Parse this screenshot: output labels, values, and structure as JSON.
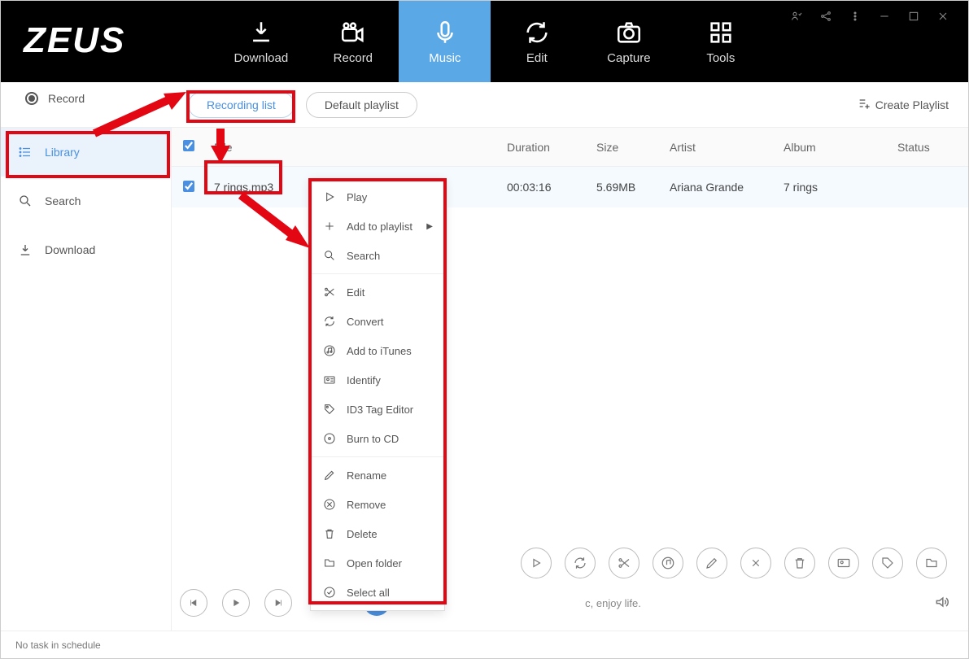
{
  "app": {
    "logo": "ZEUS"
  },
  "nav": [
    {
      "label": "Download"
    },
    {
      "label": "Record"
    },
    {
      "label": "Music"
    },
    {
      "label": "Edit"
    },
    {
      "label": "Capture"
    },
    {
      "label": "Tools"
    }
  ],
  "toolbar": {
    "record": "Record",
    "recording_list": "Recording list",
    "default_playlist": "Default playlist",
    "create_playlist": "Create Playlist"
  },
  "sidebar": {
    "library": "Library",
    "search": "Search",
    "download": "Download"
  },
  "table": {
    "headers": {
      "file": "File",
      "duration": "Duration",
      "size": "Size",
      "artist": "Artist",
      "album": "Album",
      "status": "Status"
    },
    "rows": [
      {
        "file": "7 rings.mp3",
        "duration": "00:03:16",
        "size": "5.69MB",
        "artist": "Ariana Grande",
        "album": "7 rings",
        "status": ""
      }
    ]
  },
  "context_menu": {
    "play": "Play",
    "add_to_playlist": "Add to playlist",
    "search": "Search",
    "edit": "Edit",
    "convert": "Convert",
    "add_to_itunes": "Add to iTunes",
    "identify": "Identify",
    "id3": "ID3 Tag Editor",
    "burn": "Burn to CD",
    "rename": "Rename",
    "remove": "Remove",
    "delete": "Delete",
    "open_folder": "Open folder",
    "select_all": "Select all"
  },
  "playbar": {
    "slogan": "c, enjoy life."
  },
  "statusbar": {
    "text": "No task in schedule"
  }
}
